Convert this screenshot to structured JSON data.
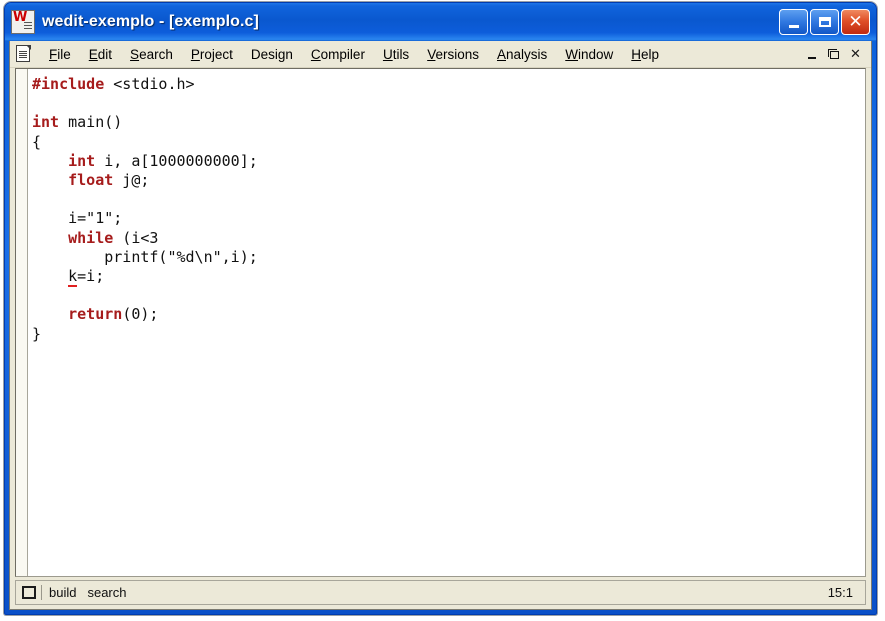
{
  "window": {
    "title": "wedit-exemplo - [exemplo.c]",
    "app_icon": "wedit-w-icon",
    "controls": {
      "minimize": "minimize-icon",
      "maximize": "maximize-icon",
      "close": "close-icon"
    }
  },
  "menu": {
    "document_icon": "document-icon",
    "items": [
      {
        "label": "File",
        "accel_index": 0
      },
      {
        "label": "Edit",
        "accel_index": 0
      },
      {
        "label": "Search",
        "accel_index": 0
      },
      {
        "label": "Project",
        "accel_index": 0
      },
      {
        "label": "Design",
        "accel_index": 4
      },
      {
        "label": "Compiler",
        "accel_index": 0
      },
      {
        "label": "Utils",
        "accel_index": 0
      },
      {
        "label": "Versions",
        "accel_index": 0
      },
      {
        "label": "Analysis",
        "accel_index": 0
      },
      {
        "label": "Window",
        "accel_index": 0
      },
      {
        "label": "Help",
        "accel_index": 0
      }
    ],
    "mdi_controls": {
      "minimize": "mdi-minimize-icon",
      "restore": "mdi-restore-icon",
      "close": "mdi-close-icon"
    }
  },
  "editor": {
    "filename": "exemplo.c",
    "language": "c",
    "colors": {
      "keyword": "#a61c1c",
      "text": "#111111",
      "background": "#ffffff",
      "error_underline": "#e02020"
    },
    "lines": [
      {
        "n": 1,
        "tokens": [
          {
            "t": "#include",
            "c": "pp"
          },
          {
            "t": " <stdio.h>",
            "c": ""
          }
        ]
      },
      {
        "n": 2,
        "tokens": []
      },
      {
        "n": 3,
        "tokens": [
          {
            "t": "int",
            "c": "kw"
          },
          {
            "t": " main()",
            "c": ""
          }
        ]
      },
      {
        "n": 4,
        "tokens": [
          {
            "t": "{",
            "c": ""
          }
        ]
      },
      {
        "n": 5,
        "tokens": [
          {
            "t": "    ",
            "c": ""
          },
          {
            "t": "int",
            "c": "kw"
          },
          {
            "t": " i, a[1000000000];",
            "c": ""
          }
        ]
      },
      {
        "n": 6,
        "tokens": [
          {
            "t": "    ",
            "c": ""
          },
          {
            "t": "float",
            "c": "kw"
          },
          {
            "t": " j@;",
            "c": ""
          }
        ]
      },
      {
        "n": 7,
        "tokens": []
      },
      {
        "n": 8,
        "tokens": [
          {
            "t": "    i=\"1\";",
            "c": ""
          }
        ]
      },
      {
        "n": 9,
        "tokens": [
          {
            "t": "    ",
            "c": ""
          },
          {
            "t": "while",
            "c": "kw"
          },
          {
            "t": " (i<3",
            "c": ""
          }
        ]
      },
      {
        "n": 10,
        "tokens": [
          {
            "t": "        printf(\"%d\\n\",i);",
            "c": ""
          }
        ]
      },
      {
        "n": 11,
        "tokens": [
          {
            "t": "    ",
            "c": ""
          },
          {
            "t": "k",
            "c": "err"
          },
          {
            "t": "=i;",
            "c": ""
          }
        ]
      },
      {
        "n": 12,
        "tokens": []
      },
      {
        "n": 13,
        "tokens": [
          {
            "t": "    ",
            "c": ""
          },
          {
            "t": "return",
            "c": "kw"
          },
          {
            "t": "(0);",
            "c": ""
          }
        ]
      },
      {
        "n": 14,
        "tokens": [
          {
            "t": "}",
            "c": ""
          }
        ]
      }
    ]
  },
  "status": {
    "icon": "output-pane-icon",
    "panes": [
      "build",
      "search"
    ],
    "position": "15:1"
  }
}
